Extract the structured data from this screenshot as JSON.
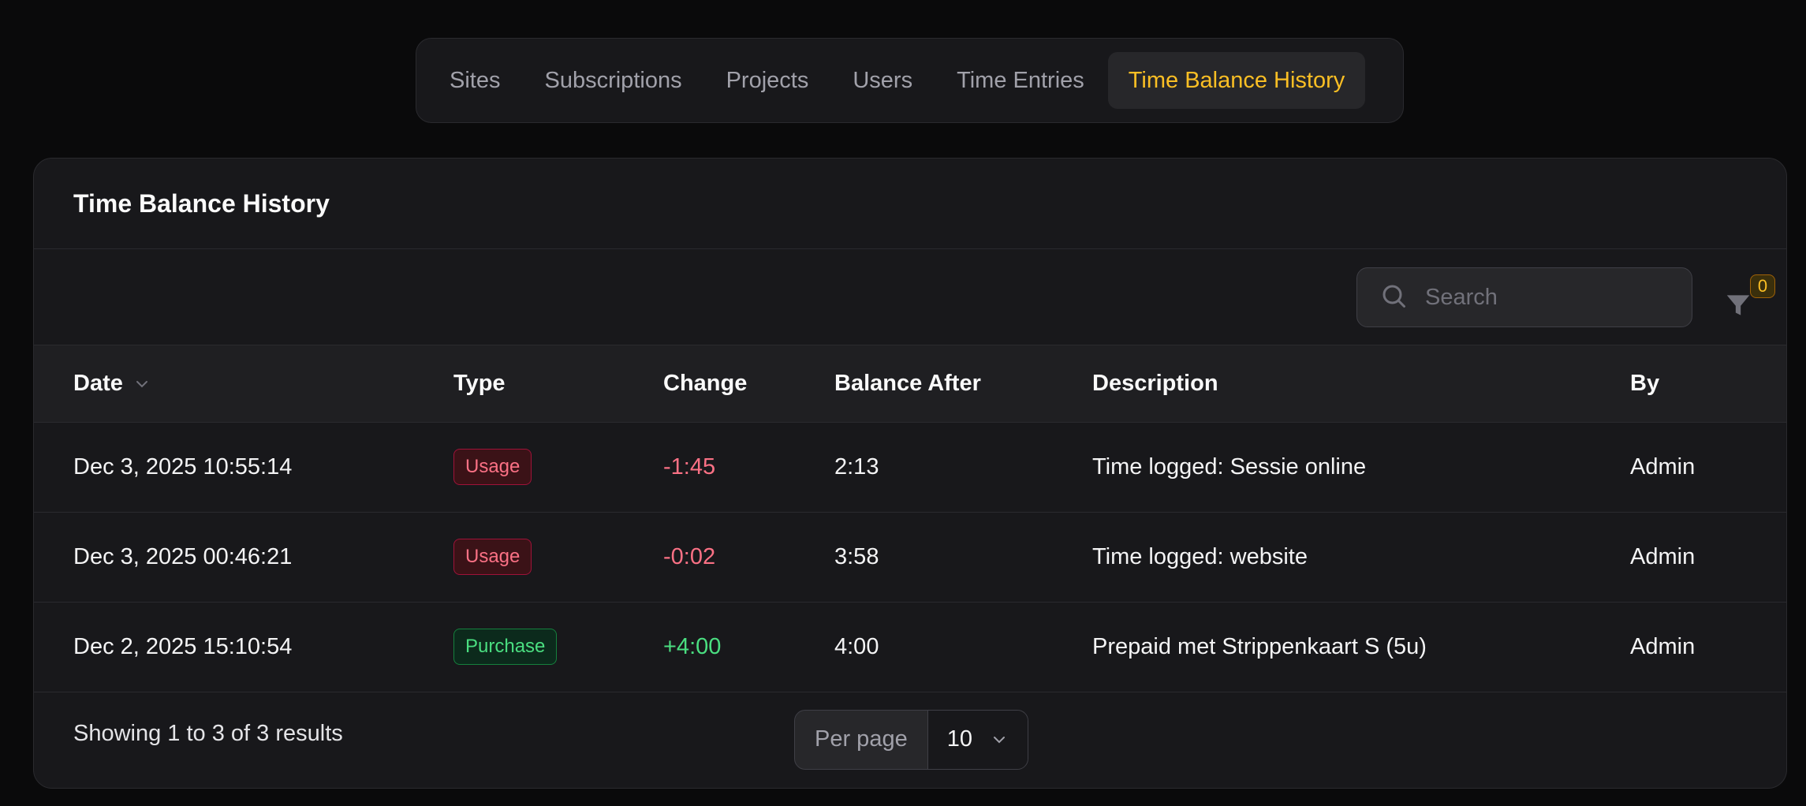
{
  "nav": {
    "tabs": [
      {
        "label": "Sites"
      },
      {
        "label": "Subscriptions"
      },
      {
        "label": "Projects"
      },
      {
        "label": "Users"
      },
      {
        "label": "Time Entries"
      },
      {
        "label": "Time Balance History",
        "active": true
      }
    ]
  },
  "card": {
    "title": "Time Balance History"
  },
  "toolbar": {
    "search_placeholder": "Search",
    "filter_count": "0"
  },
  "table": {
    "columns": {
      "date": "Date",
      "type": "Type",
      "change": "Change",
      "balance_after": "Balance After",
      "description": "Description",
      "by": "By"
    },
    "rows": [
      {
        "date": "Dec 3, 2025 10:55:14",
        "type": "Usage",
        "change": "-1:45",
        "balance_after": "2:13",
        "description": "Time logged: Sessie online",
        "by": "Admin"
      },
      {
        "date": "Dec 3, 2025 00:46:21",
        "type": "Usage",
        "change": "-0:02",
        "balance_after": "3:58",
        "description": "Time logged: website",
        "by": "Admin"
      },
      {
        "date": "Dec 2, 2025 15:10:54",
        "type": "Purchase",
        "change": "+4:00",
        "balance_after": "4:00",
        "description": "Prepaid met Strippenkaart S (5u)",
        "by": "Admin"
      }
    ]
  },
  "footer": {
    "showing": "Showing 1 to 3 of 3 results",
    "per_page_label": "Per page",
    "per_page_value": "10"
  },
  "colors": {
    "accent": "#fbbf24",
    "negative": "#fb7185",
    "positive": "#4ade80",
    "background": "#0a0a0b",
    "card": "#18181b"
  },
  "icons": {
    "search": "search-icon",
    "filter": "filter-icon",
    "sort": "chevron-down-icon",
    "select": "chevron-down-icon"
  }
}
